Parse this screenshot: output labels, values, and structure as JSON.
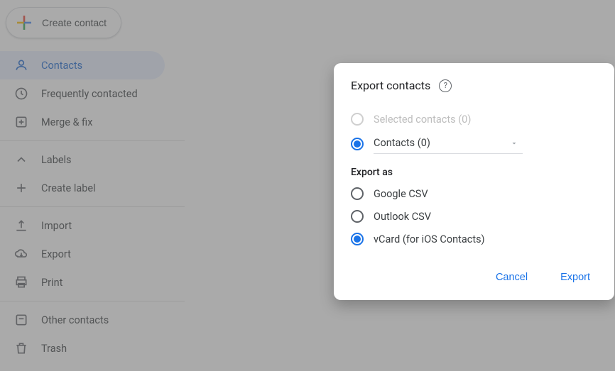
{
  "sidebar": {
    "create_label": "Create contact",
    "items": [
      {
        "label": "Contacts"
      },
      {
        "label": "Frequently contacted"
      },
      {
        "label": "Merge & fix"
      }
    ],
    "labels_section": {
      "header": "Labels",
      "create_label": "Create label"
    },
    "actions": [
      {
        "label": "Import"
      },
      {
        "label": "Export"
      },
      {
        "label": "Print"
      }
    ],
    "footer": [
      {
        "label": "Other contacts"
      },
      {
        "label": "Trash"
      }
    ]
  },
  "dialog": {
    "title": "Export contacts",
    "source_group": {
      "selected_label": "Selected contacts (0)",
      "dropdown_value": "Contacts (0)"
    },
    "export_as_label": "Export as",
    "formats": [
      {
        "label": "Google CSV",
        "selected": false
      },
      {
        "label": "Outlook CSV",
        "selected": false
      },
      {
        "label": "vCard (for iOS Contacts)",
        "selected": true
      }
    ],
    "cancel_label": "Cancel",
    "export_label": "Export"
  }
}
